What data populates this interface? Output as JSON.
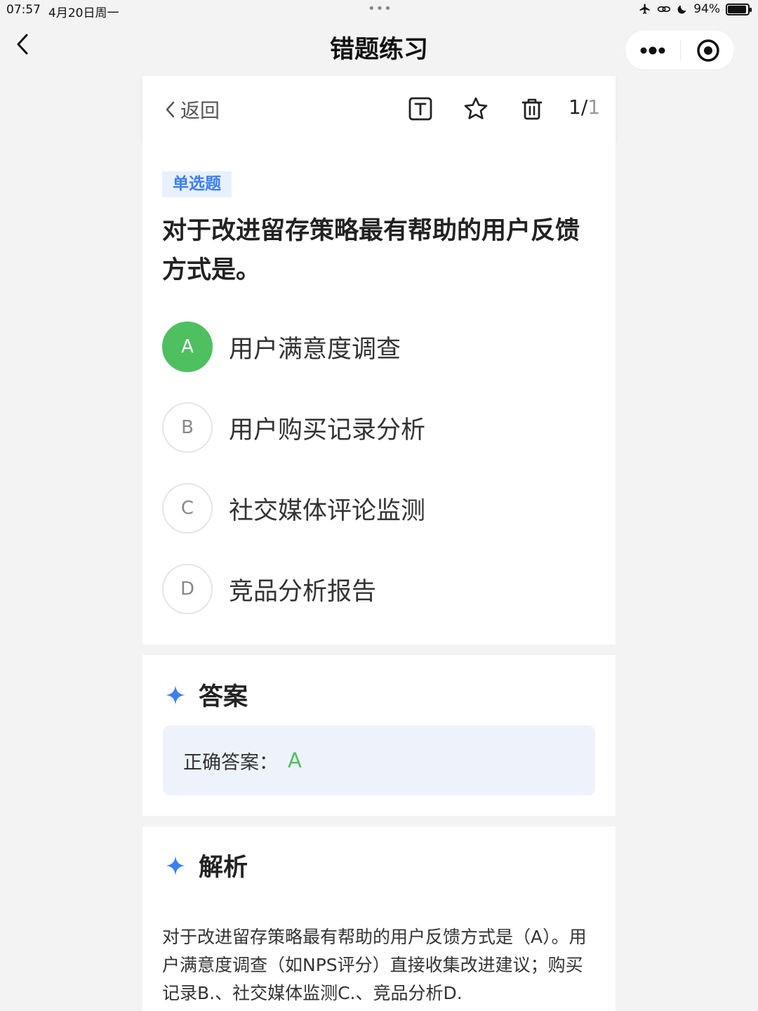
{
  "status_bar": {
    "time": "07:57",
    "date": "4月20日周一",
    "dots": "•••",
    "battery": "94%",
    "battery_level": 0.94,
    "icons": [
      "airplane-icon",
      "link-icon",
      "moon-icon",
      "battery-icon"
    ]
  },
  "nav": {
    "title": "错题练习",
    "icons": [
      "chevron-left-icon",
      "more-icon",
      "target-icon"
    ]
  },
  "toolbar": {
    "back_label": "返回",
    "current": "1",
    "separator": "/",
    "total": "1",
    "icons": [
      "text-icon",
      "star-icon",
      "trash-icon"
    ]
  },
  "question": {
    "type": "单选题",
    "text": "对于改进留存策略最有帮助的用户反馈方式是。",
    "options": [
      {
        "letter": "A",
        "text": "用户满意度调查",
        "correct": true
      },
      {
        "letter": "B",
        "text": "用户购买记录分析",
        "correct": false
      },
      {
        "letter": "C",
        "text": "社交媒体评论监测",
        "correct": false
      },
      {
        "letter": "D",
        "text": "竞品分析报告",
        "correct": false
      }
    ]
  },
  "answer": {
    "title": "答案",
    "label": "正确答案：",
    "value": "A"
  },
  "analysis": {
    "title": "解析",
    "text": "对于改进留存策略最有帮助的用户反馈方式是（A）。用户满意度调查（如NPS评分）直接收集改进建议；购买记录B.、社交媒体监测C.、竞品分析D."
  },
  "colors": {
    "accent_blue": "#3b7ff0",
    "correct_green": "#4ec05f",
    "tag_bg": "#e8f0fd",
    "answer_bg": "#eef3fb"
  }
}
